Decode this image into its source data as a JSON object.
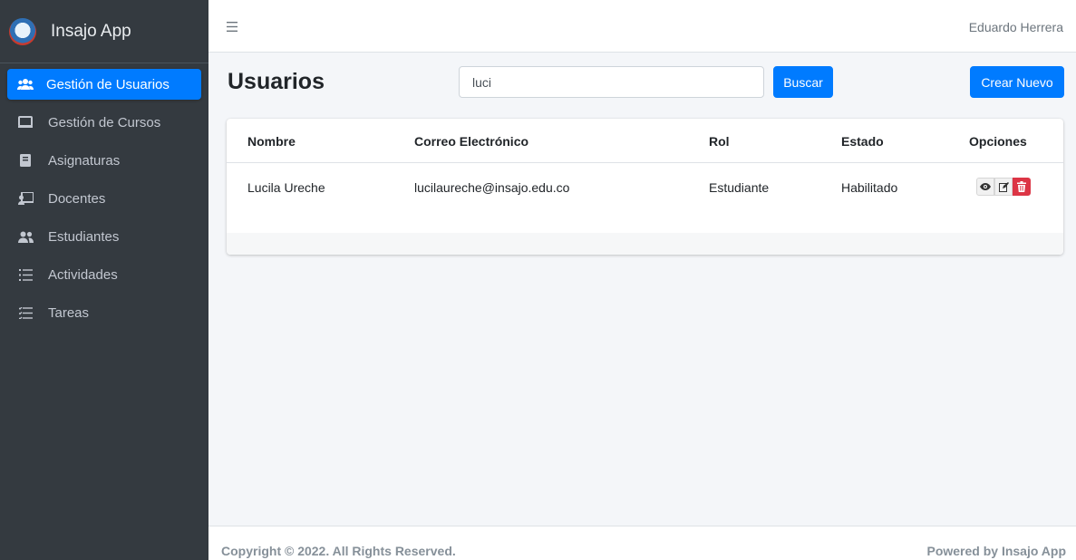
{
  "app": {
    "name": "Insajo App",
    "logo_icon": "school-shield-logo-icon"
  },
  "sidebar": {
    "items": [
      {
        "label": "Gestión de Usuarios",
        "icon": "users-icon",
        "active": true
      },
      {
        "label": "Gestión de Cursos",
        "icon": "monitor-icon"
      },
      {
        "label": "Asignaturas",
        "icon": "book-icon"
      },
      {
        "label": "Docentes",
        "icon": "chalkboard-teacher-icon"
      },
      {
        "label": "Estudiantes",
        "icon": "user-friends-icon"
      },
      {
        "label": "Actividades",
        "icon": "list-icon"
      },
      {
        "label": "Tareas",
        "icon": "tasks-icon"
      }
    ]
  },
  "topbar": {
    "menu_icon": "hamburger-menu-icon",
    "user_name": "Eduardo Herrera"
  },
  "page": {
    "title": "Usuarios",
    "search": {
      "value": "luci",
      "button_label": "Buscar"
    },
    "create_label": "Crear Nuevo"
  },
  "table": {
    "headers": [
      "Nombre",
      "Correo Electrónico",
      "Rol",
      "Estado",
      "Opciones"
    ],
    "rows": [
      {
        "nombre": "Lucila Ureche",
        "correo": "lucilaureche@insajo.edu.co",
        "rol": "Estudiante",
        "estado": "Habilitado",
        "options": [
          "view-eye-icon",
          "edit-icon",
          "delete-trash-icon"
        ]
      }
    ]
  },
  "footer": {
    "copyright": "Copyright © 2022. All Rights Reserved.",
    "powered": "Powered by Insajo App"
  },
  "colors": {
    "primary": "#007bff",
    "sidebar_bg": "#343a40",
    "danger": "#dc3545",
    "content_bg": "#f4f6f9"
  }
}
